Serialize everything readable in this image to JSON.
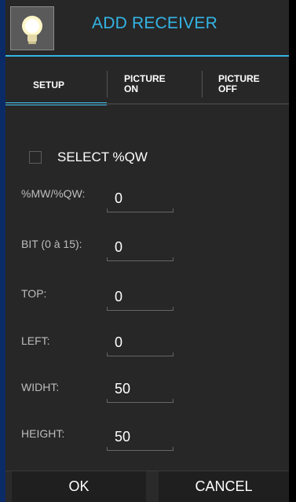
{
  "dialog": {
    "title": "ADD RECEIVER",
    "icon": "lightbulb-icon"
  },
  "tabs": [
    {
      "line1": "SETUP",
      "line2": "",
      "selected": true
    },
    {
      "line1": "PICTURE",
      "line2": "ON",
      "selected": false
    },
    {
      "line1": "PICTURE",
      "line2": "OFF",
      "selected": false
    }
  ],
  "checkbox": {
    "label": "SELECT %QW",
    "checked": false
  },
  "fields": [
    {
      "label": "%MW/%QW:",
      "value": "0"
    },
    {
      "label": "BIT (0 à 15):",
      "value": "0"
    },
    {
      "label": "TOP:",
      "value": "0"
    },
    {
      "label": "LEFT:",
      "value": "0"
    },
    {
      "label": "WIDHT:",
      "value": "50"
    },
    {
      "label": "HEIGHT:",
      "value": "50"
    }
  ],
  "buttons": {
    "ok": "OK",
    "cancel": "CANCEL"
  },
  "colors": {
    "accent": "#33b5e5",
    "background": "#272727"
  }
}
